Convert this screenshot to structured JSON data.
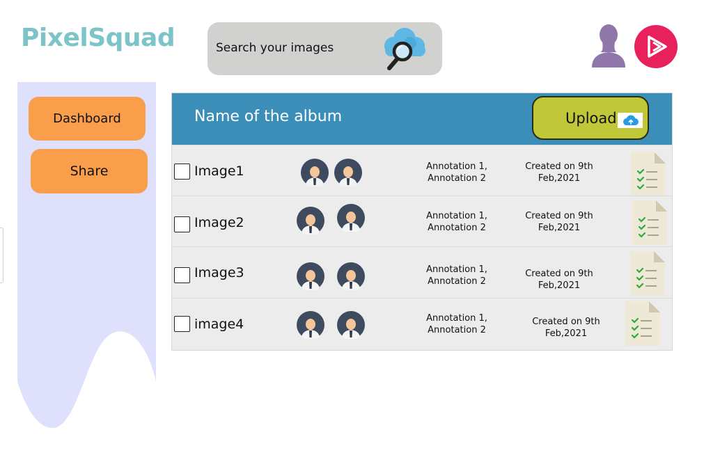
{
  "app": {
    "logo": "PixelSquad"
  },
  "search": {
    "placeholder": "Search your images",
    "icon": "cloud-search-icon"
  },
  "header_icons": {
    "user": "user-icon",
    "play": "play-icon"
  },
  "colors": {
    "logo": "#7cc4c8",
    "sidebar": "#dfe1fc",
    "nav_button": "#f99e4b",
    "album_header": "#3b8eb7",
    "upload_button": "#c0c83a",
    "row_background": "#ececec",
    "play_button": "#e8205b",
    "user_icon": "#9177a9"
  },
  "sidebar": {
    "items": [
      {
        "label": "Dashboard"
      },
      {
        "label": "Share"
      }
    ]
  },
  "album": {
    "title": "Name of the album",
    "upload_label": "Upload",
    "upload_icon": "cloud-upload-icon",
    "rows": [
      {
        "name": "Image1",
        "annotation_line1": "Annotation 1,",
        "annotation_line2": "Annotation 2",
        "created_line1": "Created on 9th",
        "created_line2": "Feb,2021",
        "checked": false
      },
      {
        "name": "Image2",
        "annotation_line1": "Annotation 1,",
        "annotation_line2": "Annotation 2",
        "created_line1": "Created on 9th",
        "created_line2": "Feb,2021",
        "checked": false
      },
      {
        "name": "Image3",
        "annotation_line1": "Annotation 1,",
        "annotation_line2": "Annotation 2",
        "created_line1": "Created on 9th",
        "created_line2": "Feb,2021",
        "checked": false
      },
      {
        "name": "image4",
        "annotation_line1": "Annotation 1,",
        "annotation_line2": "Annotation 2",
        "created_line1": "Created on 9th",
        "created_line2": "Feb,2021",
        "checked": false
      }
    ]
  }
}
